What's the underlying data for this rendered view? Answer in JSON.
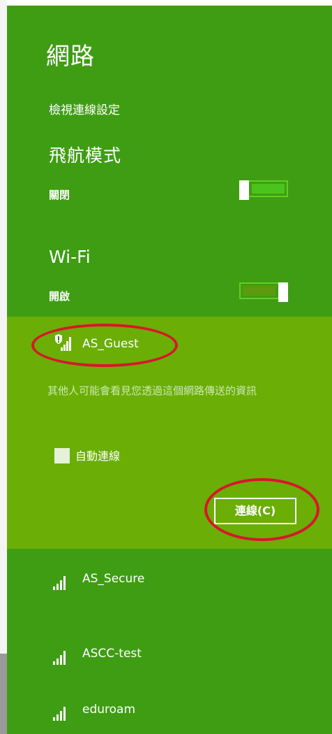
{
  "panel": {
    "title": "網路",
    "view_settings": "檢視連線設定",
    "airplane_mode": {
      "title": "飛航模式",
      "state": "關閉"
    },
    "wifi": {
      "title": "Wi-Fi",
      "state": "開啟"
    }
  },
  "networks": {
    "expanded": {
      "name": "AS_Guest",
      "security_warning": "其他人可能會看見您透過這個網路傳送的資訊",
      "auto_connect_label": "自動連線",
      "connect_button": "連線(C)"
    },
    "list": [
      {
        "name": "AS_Secure"
      },
      {
        "name": "ASCC-test"
      },
      {
        "name": "eduroam"
      }
    ]
  },
  "colors": {
    "panel_bg": "#3f9d13",
    "expanded_bg": "#6aae06",
    "annotation_red": "#d8162b"
  }
}
